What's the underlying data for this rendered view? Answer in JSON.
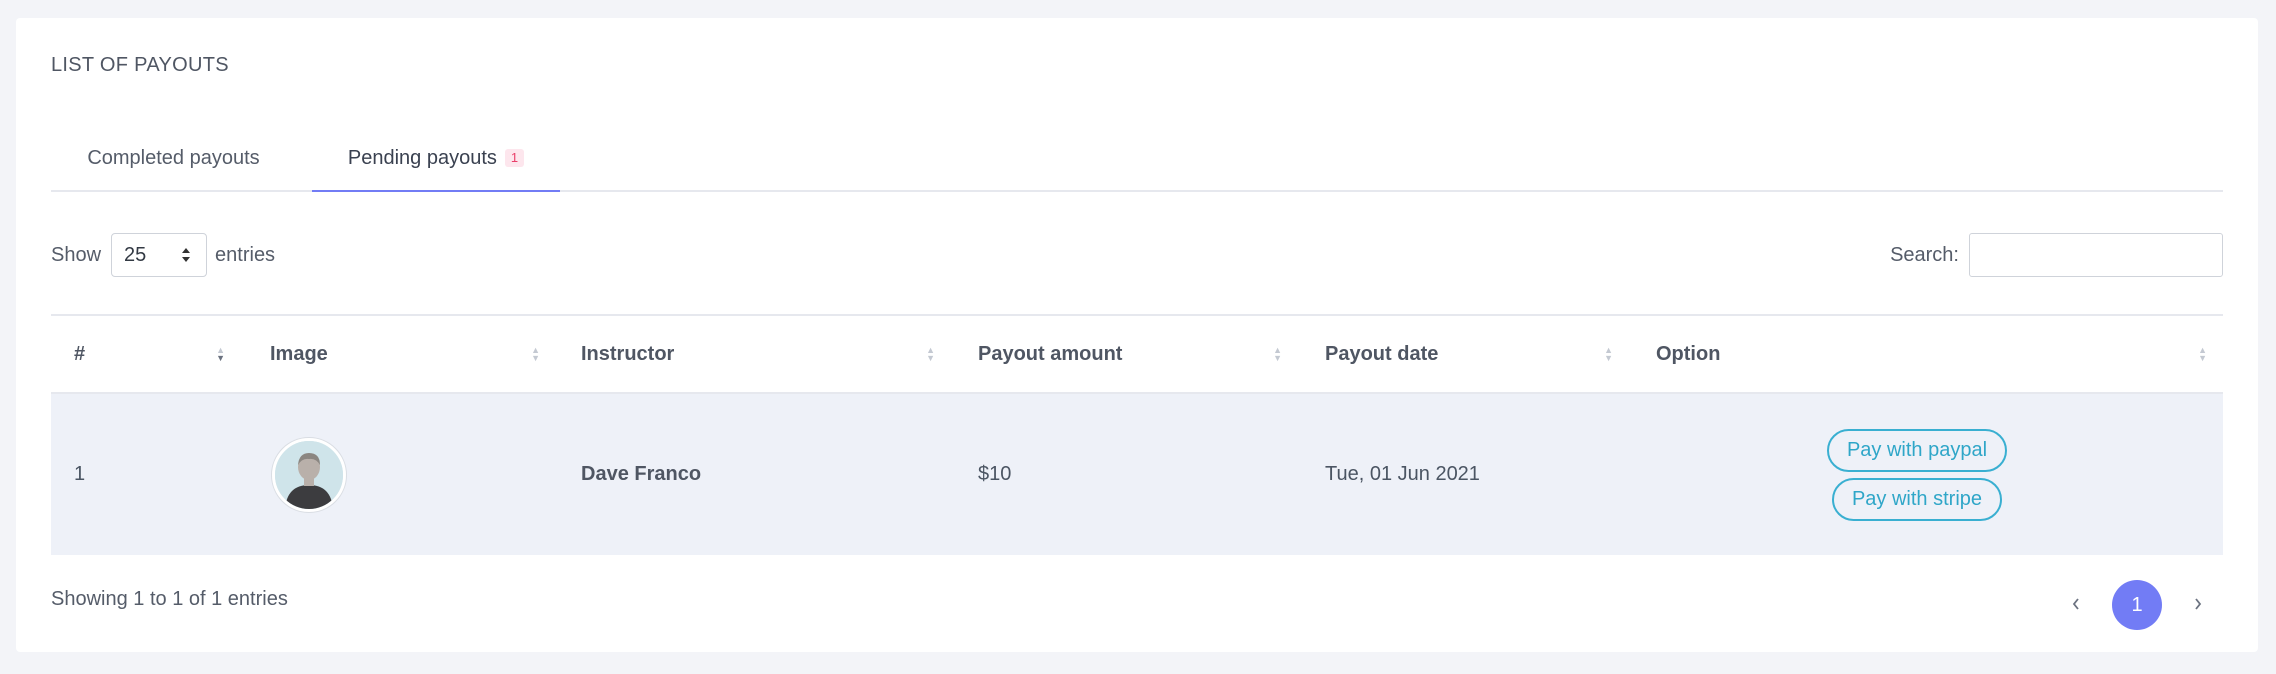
{
  "card": {
    "title": "LIST OF PAYOUTS"
  },
  "tabs": [
    {
      "label": "Completed payouts"
    },
    {
      "label": "Pending payouts",
      "badge": "1"
    }
  ],
  "length_control": {
    "prefix": "Show",
    "value": "25",
    "suffix": "entries"
  },
  "search": {
    "label": "Search:",
    "value": ""
  },
  "table": {
    "columns": [
      "#",
      "Image",
      "Instructor",
      "Payout amount",
      "Payout date",
      "Option"
    ],
    "rows": [
      {
        "index": "1",
        "instructor": "Dave Franco",
        "amount": "$10",
        "date": "Tue, 01 Jun 2021",
        "actions": [
          "Pay with paypal",
          "Pay with stripe"
        ]
      }
    ]
  },
  "footer": {
    "info": "Showing 1 to 1 of 1 entries"
  },
  "pagination": {
    "prev_icon": "chevron-left",
    "current": "1",
    "next_icon": "chevron-right"
  },
  "colors": {
    "accent": "#727cf5",
    "info": "#39afd1",
    "badge_text": "#ea3f6a",
    "row_bg": "#eef1f8"
  }
}
